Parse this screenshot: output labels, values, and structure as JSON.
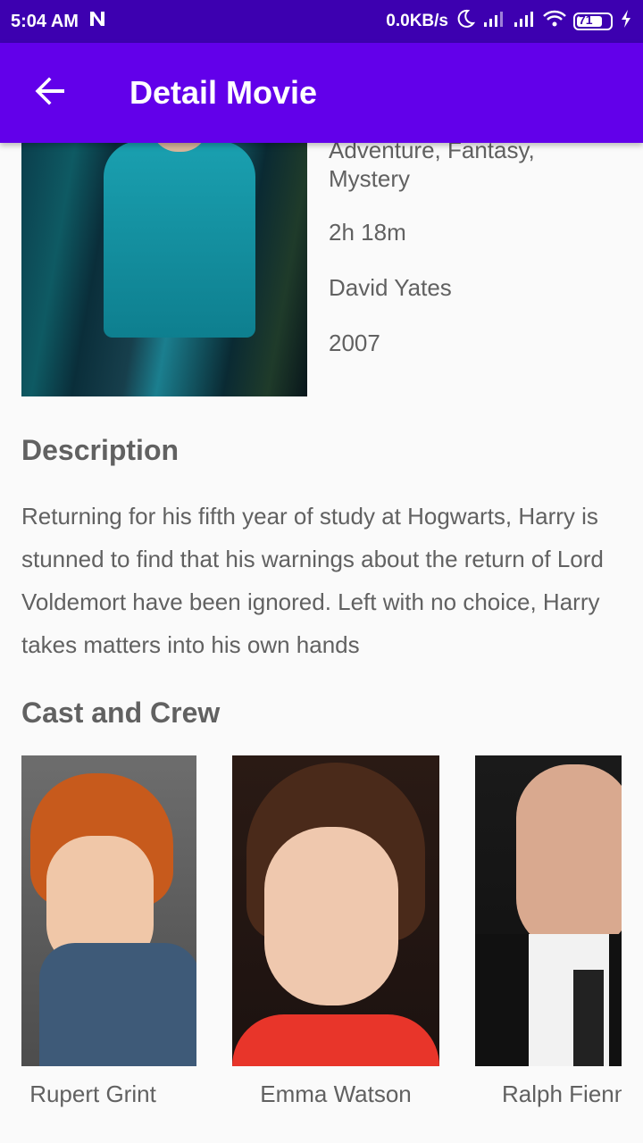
{
  "status_bar": {
    "time": "5:04 AM",
    "network_speed": "0.0KB/s",
    "battery": "71",
    "icons": [
      "notification-n-icon",
      "moon-icon",
      "signal-icon",
      "signal-icon",
      "wifi-icon",
      "battery-icon",
      "charging-icon"
    ]
  },
  "app_bar": {
    "title": "Detail Movie",
    "back_icon": "arrow-left-icon",
    "color": "#6200ea",
    "status_color": "#3d00b0"
  },
  "movie": {
    "genre": "Adventure, Fantasy, Mystery",
    "runtime": "2h 18m",
    "director": "David Yates",
    "year": "2007"
  },
  "description": {
    "title": "Description",
    "text": "Returning for his fifth year of study at Hogwarts, Harry is stunned to find that his warnings about the return of Lord Voldemort have been ignored. Left with no choice, Harry takes matters into his own hands"
  },
  "cast": {
    "title": "Cast and Crew",
    "members": [
      {
        "name": "Rupert Grint"
      },
      {
        "name": "Emma Watson"
      },
      {
        "name": "Ralph Fiennes"
      }
    ]
  }
}
